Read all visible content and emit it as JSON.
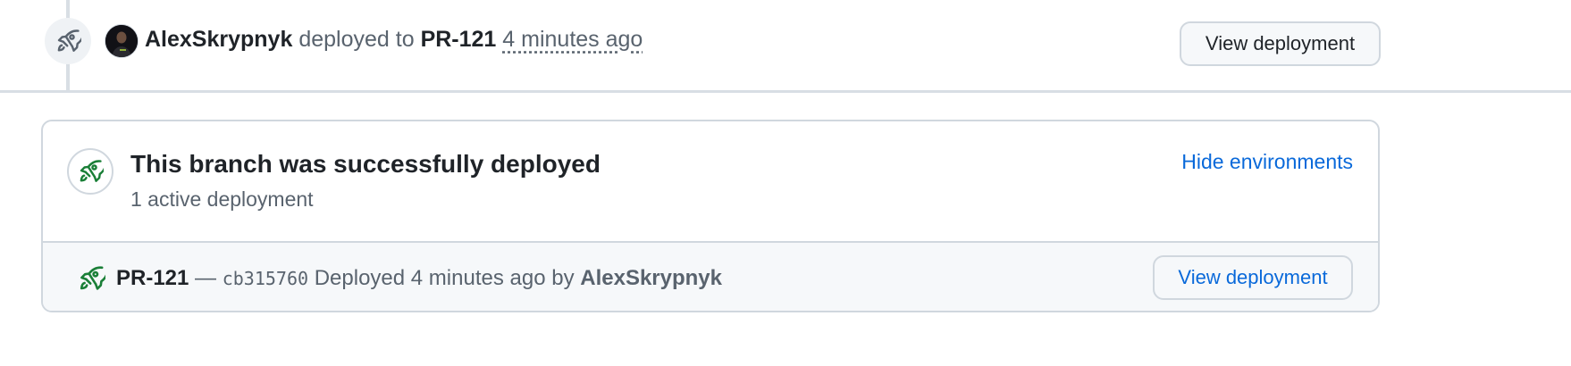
{
  "event": {
    "actor": "AlexSkrypnyk",
    "action": "deployed to",
    "environment": "PR-121",
    "time": "4 minutes ago",
    "view_button": "View deployment",
    "icon": "rocket-icon"
  },
  "deploy_card": {
    "title": "This branch was successfully deployed",
    "subtitle": "1 active deployment",
    "hide_link": "Hide environments",
    "icon": "rocket-icon",
    "accent_color": "#1a7f37",
    "deployment": {
      "environment": "PR-121",
      "separator": "—",
      "sha": "cb315760",
      "status_text": "Deployed 4 minutes ago by",
      "actor": "AlexSkrypnyk",
      "view_button": "View deployment"
    }
  },
  "colors": {
    "link": "#0969da",
    "muted": "#59636e",
    "border": "#d0d7de"
  }
}
